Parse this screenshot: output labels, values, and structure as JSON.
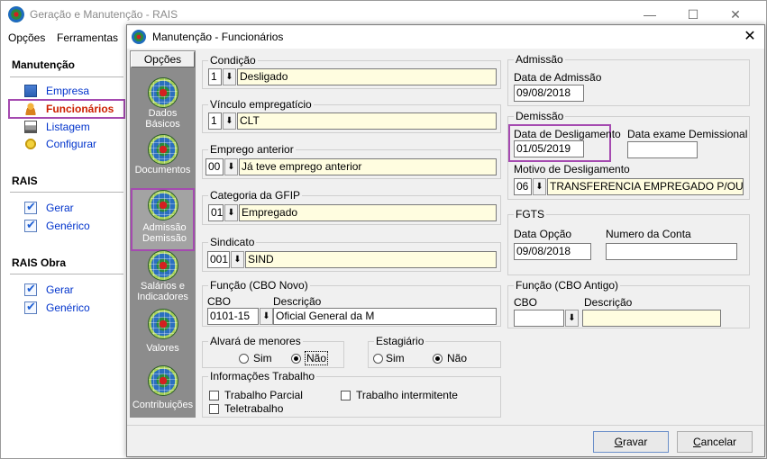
{
  "main_window": {
    "title": "Geração e Manutenção - RAIS",
    "menu": [
      "Opções",
      "Ferramentas"
    ],
    "controls": {
      "minimize": "—",
      "maximize": "☐",
      "close": "✕"
    }
  },
  "left_panel": {
    "sections": [
      {
        "title": "Manutenção",
        "items": [
          {
            "label": "Empresa",
            "icon": "document-icon"
          },
          {
            "label": "Funcionários",
            "icon": "person-icon",
            "active": true
          },
          {
            "label": "Listagem",
            "icon": "printer-icon"
          },
          {
            "label": "Configurar",
            "icon": "gear-icon"
          }
        ]
      },
      {
        "title": "RAIS",
        "items": [
          {
            "label": "Gerar",
            "icon": "checkbox-icon"
          },
          {
            "label": "Genérico",
            "icon": "checkbox-icon"
          }
        ]
      },
      {
        "title": "RAIS Obra",
        "items": [
          {
            "label": "Gerar",
            "icon": "checkbox-icon"
          },
          {
            "label": "Genérico",
            "icon": "checkbox-icon"
          }
        ]
      }
    ]
  },
  "dialog": {
    "title": "Manutenção - Funcionários",
    "close": "✕",
    "sidebar": {
      "header": "Opções",
      "items": [
        {
          "line1": "Dados",
          "line2": "Básicos"
        },
        {
          "line1": "Documentos",
          "line2": ""
        },
        {
          "line1": "Admissão",
          "line2": "Demissão",
          "active": true
        },
        {
          "line1": "Salários e",
          "line2": "Indicadores"
        },
        {
          "line1": "Valores",
          "line2": ""
        },
        {
          "line1": "Contribuições",
          "line2": ""
        }
      ]
    },
    "condicao": {
      "label": "Condição",
      "code": "1",
      "value": "Desligado"
    },
    "vinculo": {
      "label": "Vínculo empregatício",
      "code": "1",
      "value": "CLT"
    },
    "emprego_anterior": {
      "label": "Emprego anterior",
      "code": "00",
      "value": "Já teve emprego anterior"
    },
    "categoria_gfip": {
      "label": "Categoria da GFIP",
      "code": "01",
      "value": "Empregado"
    },
    "sindicato": {
      "label": "Sindicato",
      "code": "001",
      "value": "SIND"
    },
    "funcao_novo": {
      "label": "Função (CBO Novo)",
      "cbo_label": "CBO",
      "desc_label": "Descrição",
      "cbo": "0101-15",
      "descricao": "Oficial General da M"
    },
    "alvara": {
      "label": "Alvará de menores",
      "sim": "Sim",
      "nao": "Não",
      "selected": "nao"
    },
    "estagiario": {
      "label": "Estagiário",
      "sim": "Sim",
      "nao": "Não",
      "selected": "nao"
    },
    "info_trabalho": {
      "label": "Informações Trabalho",
      "parcial": "Trabalho Parcial",
      "intermitente": "Trabalho intermitente",
      "teletrabalho": "Teletrabalho"
    },
    "admissao": {
      "label": "Admissão",
      "data_label": "Data de Admissão",
      "data": "09/08/2018"
    },
    "demissao": {
      "label": "Demissão",
      "deslig_label": "Data de Desligamento",
      "deslig": "01/05/2019",
      "exame_label": "Data exame Demissional",
      "exame": "",
      "motivo_label": "Motivo de Desligamento",
      "motivo_code": "06",
      "motivo": "TRANSFERENCIA EMPREGADO P/OUTR"
    },
    "fgts": {
      "label": "FGTS",
      "opcao_label": "Data Opção",
      "opcao": "09/08/2018",
      "conta_label": "Numero da Conta",
      "conta": ""
    },
    "funcao_antigo": {
      "label": "Função (CBO Antigo)",
      "cbo_label": "CBO",
      "desc_label": "Descrição",
      "cbo": "",
      "descricao": ""
    },
    "buttons": {
      "gravar_u": "G",
      "gravar_rest": "ravar",
      "cancelar_u": "C",
      "cancelar_rest": "ancelar"
    }
  },
  "colors": {
    "highlight": "#a54ab0",
    "link": "#0033cc",
    "active_link": "#cc1f00",
    "field_bg": "#fffde0",
    "sidebar_bg": "#8c8c8c"
  }
}
